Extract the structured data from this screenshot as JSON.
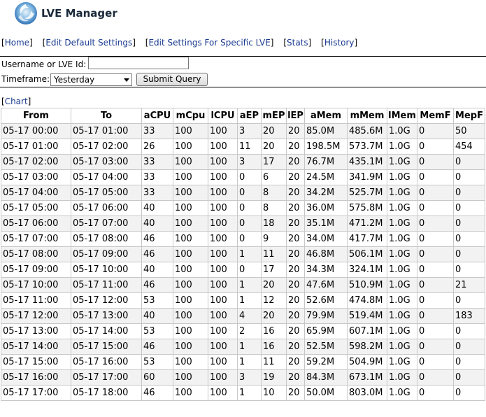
{
  "header": {
    "title": "LVE Manager"
  },
  "nav": [
    {
      "label": "Home"
    },
    {
      "label": "Edit Default Settings"
    },
    {
      "label": "Edit Settings For Specific LVE"
    },
    {
      "label": "Stats"
    },
    {
      "label": "History"
    }
  ],
  "form": {
    "user_label": "Username or LVE Id:",
    "user_value": "",
    "timeframe_label": "Timeframe:",
    "timeframe_value": "Yesterday",
    "submit_label": "Submit Query"
  },
  "chart_link": "Chart",
  "table": {
    "columns": [
      "From",
      "To",
      "aCPU",
      "mCpu",
      "lCPU",
      "aEP",
      "mEP",
      "lEP",
      "aMem",
      "mMem",
      "lMem",
      "MemF",
      "MepF"
    ],
    "rows": [
      [
        "05-17 00:00",
        "05-17 01:00",
        "33",
        "100",
        "100",
        "3",
        "20",
        "20",
        "85.0M",
        "485.6M",
        "1.0G",
        "0",
        "50"
      ],
      [
        "05-17 01:00",
        "05-17 02:00",
        "26",
        "100",
        "100",
        "11",
        "20",
        "20",
        "198.5M",
        "573.7M",
        "1.0G",
        "0",
        "454"
      ],
      [
        "05-17 02:00",
        "05-17 03:00",
        "33",
        "100",
        "100",
        "3",
        "17",
        "20",
        "76.7M",
        "435.1M",
        "1.0G",
        "0",
        "0"
      ],
      [
        "05-17 03:00",
        "05-17 04:00",
        "33",
        "100",
        "100",
        "0",
        "6",
        "20",
        "24.5M",
        "341.9M",
        "1.0G",
        "0",
        "0"
      ],
      [
        "05-17 04:00",
        "05-17 05:00",
        "33",
        "100",
        "100",
        "0",
        "8",
        "20",
        "34.2M",
        "525.7M",
        "1.0G",
        "0",
        "0"
      ],
      [
        "05-17 05:00",
        "05-17 06:00",
        "40",
        "100",
        "100",
        "0",
        "8",
        "20",
        "36.0M",
        "575.8M",
        "1.0G",
        "0",
        "0"
      ],
      [
        "05-17 06:00",
        "05-17 07:00",
        "40",
        "100",
        "100",
        "0",
        "18",
        "20",
        "35.1M",
        "471.2M",
        "1.0G",
        "0",
        "0"
      ],
      [
        "05-17 07:00",
        "05-17 08:00",
        "46",
        "100",
        "100",
        "0",
        "9",
        "20",
        "34.0M",
        "417.7M",
        "1.0G",
        "0",
        "0"
      ],
      [
        "05-17 08:00",
        "05-17 09:00",
        "46",
        "100",
        "100",
        "1",
        "11",
        "20",
        "46.8M",
        "506.1M",
        "1.0G",
        "0",
        "0"
      ],
      [
        "05-17 09:00",
        "05-17 10:00",
        "40",
        "100",
        "100",
        "0",
        "17",
        "20",
        "34.3M",
        "324.1M",
        "1.0G",
        "0",
        "0"
      ],
      [
        "05-17 10:00",
        "05-17 11:00",
        "46",
        "100",
        "100",
        "1",
        "20",
        "20",
        "47.6M",
        "510.9M",
        "1.0G",
        "0",
        "21"
      ],
      [
        "05-17 11:00",
        "05-17 12:00",
        "53",
        "100",
        "100",
        "1",
        "12",
        "20",
        "52.6M",
        "474.8M",
        "1.0G",
        "0",
        "0"
      ],
      [
        "05-17 12:00",
        "05-17 13:00",
        "40",
        "100",
        "100",
        "4",
        "20",
        "20",
        "79.9M",
        "519.4M",
        "1.0G",
        "0",
        "183"
      ],
      [
        "05-17 13:00",
        "05-17 14:00",
        "53",
        "100",
        "100",
        "2",
        "16",
        "20",
        "65.9M",
        "607.1M",
        "1.0G",
        "0",
        "0"
      ],
      [
        "05-17 14:00",
        "05-17 15:00",
        "46",
        "100",
        "100",
        "1",
        "16",
        "20",
        "52.5M",
        "598.2M",
        "1.0G",
        "0",
        "0"
      ],
      [
        "05-17 15:00",
        "05-17 16:00",
        "53",
        "100",
        "100",
        "1",
        "11",
        "20",
        "59.2M",
        "504.9M",
        "1.0G",
        "0",
        "0"
      ],
      [
        "05-17 16:00",
        "05-17 17:00",
        "60",
        "100",
        "100",
        "3",
        "19",
        "20",
        "84.3M",
        "673.1M",
        "1.0G",
        "0",
        "0"
      ],
      [
        "05-17 17:00",
        "05-17 18:00",
        "46",
        "100",
        "100",
        "1",
        "10",
        "20",
        "50.0M",
        "803.0M",
        "1.0G",
        "0",
        "0"
      ]
    ]
  }
}
